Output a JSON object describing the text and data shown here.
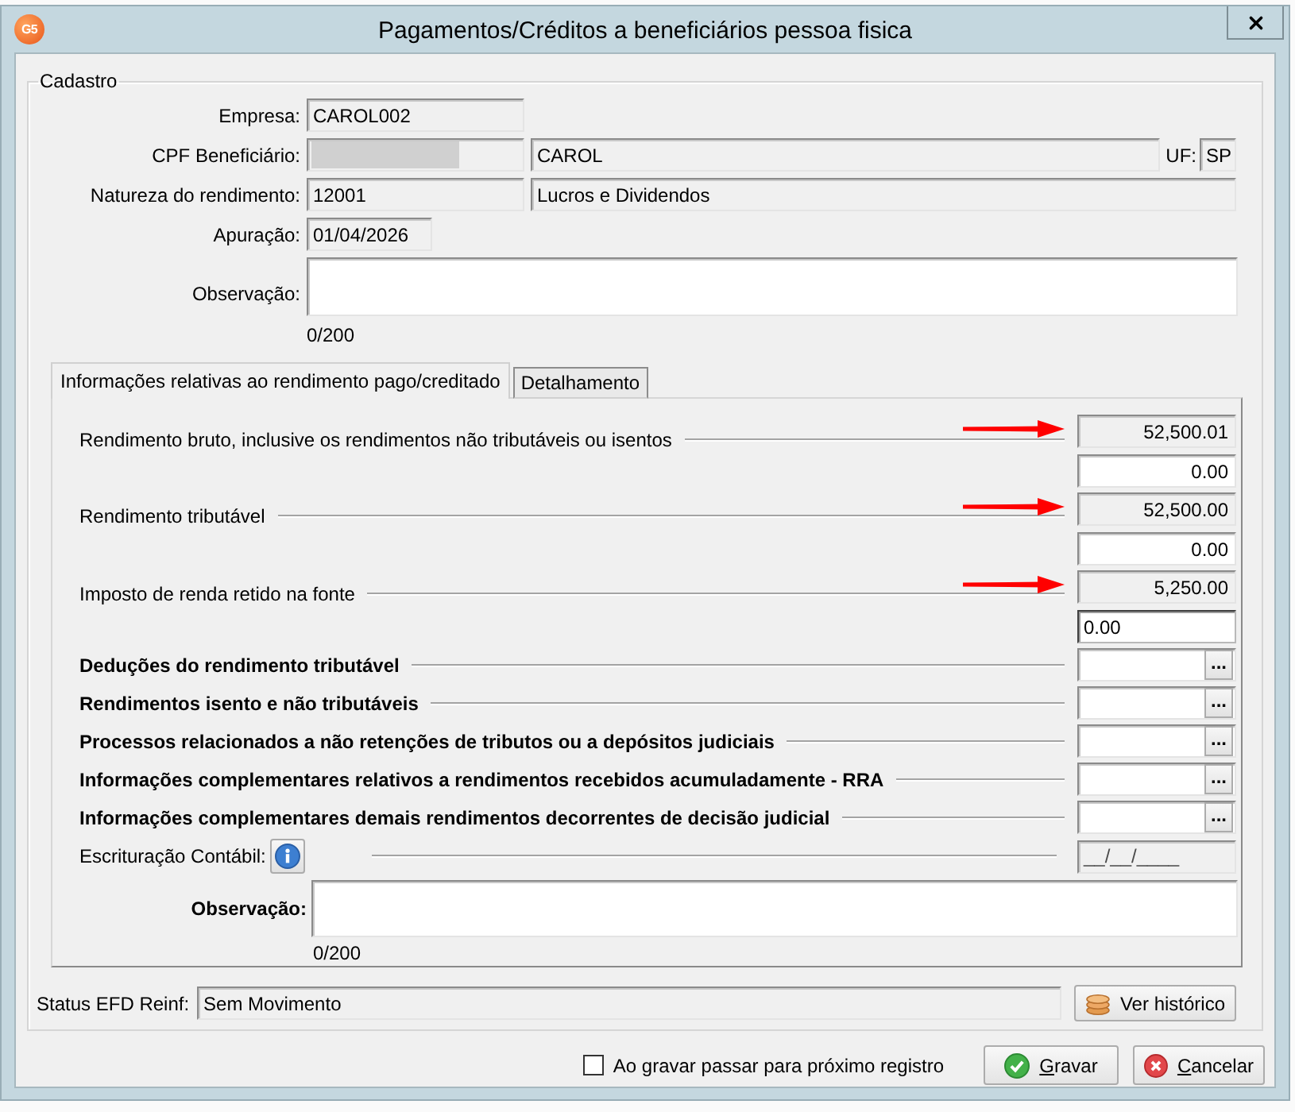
{
  "window": {
    "logo": "G5",
    "title": "Pagamentos/Créditos a beneficiários pessoa fisica"
  },
  "cadastro": {
    "title": "Cadastro",
    "empresa": {
      "label": "Empresa:",
      "value": "CAROL002"
    },
    "cpf": {
      "label": "CPF Beneficiário:",
      "redacted": true,
      "name": "CAROL",
      "uf_label": "UF:",
      "uf": "SP"
    },
    "natureza": {
      "label": "Natureza do rendimento:",
      "code": "12001",
      "description": "Lucros e Dividendos"
    },
    "apuracao": {
      "label": "Apuração:",
      "value": "01/04/2026"
    },
    "observacao": {
      "label": "Observação:",
      "counter": "0/200"
    }
  },
  "tabs": [
    {
      "label": "Informações relativas ao rendimento pago/creditado",
      "selected": true
    },
    {
      "label": "Detalhamento",
      "selected": false
    }
  ],
  "amounts": [
    {
      "label": "Rendimento bruto, inclusive os rendimentos não tributáveis ou isentos",
      "marked": true,
      "total": "52,500.01",
      "value": "0.00",
      "focused": false
    },
    {
      "label": "Rendimento tributável",
      "marked": true,
      "total": "52,500.00",
      "value": "0.00",
      "focused": false
    },
    {
      "label": "Imposto de renda retido na fonte",
      "marked": true,
      "total": "5,250.00",
      "value": "0.00",
      "focused": true
    }
  ],
  "details": [
    {
      "label": "Deduções do rendimento tributável",
      "button": "..."
    },
    {
      "label": "Rendimentos isento e não tributáveis",
      "button": "..."
    },
    {
      "label": "Processos relacionados a não retenções de tributos ou a depósitos judiciais",
      "button": "..."
    },
    {
      "label": "Informações complementares relativos a rendimentos recebidos acumuladamente - RRA",
      "button": "..."
    },
    {
      "label": "Informações complementares demais rendimentos decorrentes de decisão judicial",
      "button": "..."
    }
  ],
  "escrituracao": {
    "label": "Escrituração Contábil:",
    "date": "__/__/____"
  },
  "observacao": {
    "label": "Observação:",
    "counter": "0/200"
  },
  "status": {
    "label": "Status EFD Reinf:",
    "value": "Sem Movimento",
    "history_button": "Ver histórico"
  },
  "footer": {
    "checkbox": {
      "label": "Ao gravar passar para próximo registro",
      "checked": false
    },
    "buttons": [
      {
        "label": "Gravar",
        "kind": "confirm"
      },
      {
        "label": "Cancelar",
        "kind": "cancel"
      }
    ]
  }
}
